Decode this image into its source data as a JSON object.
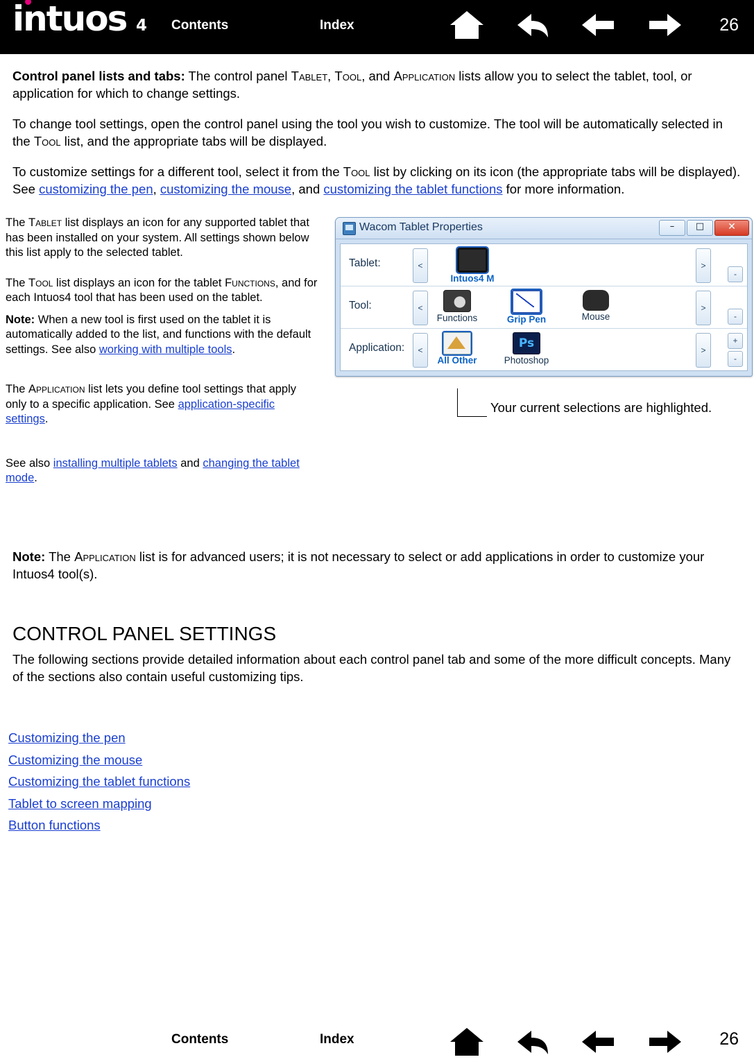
{
  "header": {
    "logo_text": "intuos",
    "logo_sub": "4",
    "contents_label": "Contents",
    "index_label": "Index",
    "page_number": "26",
    "icons": [
      "home-icon",
      "back-icon",
      "previous-page-icon",
      "next-page-icon"
    ]
  },
  "body": {
    "p1_bold": "Control panel lists and tabs:",
    "p1_a": " The control panel ",
    "p1_sc1": "Tablet",
    "p1_b": ", ",
    "p1_sc2": "Tool",
    "p1_c": ", and ",
    "p1_sc3": "Application",
    "p1_d": " lists allow you to select the tablet, tool, or application for which to change settings.",
    "p2_a": "To change tool settings, open the control panel using the tool you wish to customize.  The tool will be automatically selected in the ",
    "p2_sc": "Tool",
    "p2_b": " list, and the appropriate tabs will be displayed.",
    "p3_a": "To customize settings for a different tool, select it from the ",
    "p3_sc": "Tool",
    "p3_b": " list by clicking on its icon (the appropriate tabs will be displayed).  See ",
    "p3_link1": "customizing the pen",
    "p3_c": ", ",
    "p3_link2": "customizing the mouse",
    "p3_d": ", and ",
    "p3_link3": "customizing the tablet functions",
    "p3_e": " for more information."
  },
  "callouts": {
    "c1_a": "The ",
    "c1_sc": "Tablet",
    "c1_b": " list displays an icon for any supported tablet that has been installed on your system.  All settings shown below this list apply to the selected tablet.",
    "c2_a": "The ",
    "c2_sc1": "Tool",
    "c2_b": " list displays an icon for the tablet ",
    "c2_sc2": "Functions",
    "c2_c": ", and for each Intuos4 tool that has been used on the tablet.",
    "c3_bold": "Note:",
    "c3_a": " When a new tool is first used on the tablet it is automatically added to the list, and functions with the default settings.  See also ",
    "c3_link": "working with multiple tools",
    "c3_b": ".",
    "c4_a": "The ",
    "c4_sc": "Application",
    "c4_b": " list lets you define tool settings that apply only to a specific application.  See ",
    "c4_link": "application-specific settings",
    "c4_c": ".",
    "c5_a": "See also ",
    "c5_link1": "installing multiple tablets",
    "c5_b": " and ",
    "c5_link2": "changing the tablet mode",
    "c5_c": "."
  },
  "screenshot": {
    "window_title": "Wacom Tablet Properties",
    "window_icon": "tablet-properties-icon",
    "minimize_label": "–",
    "maximize_label": "□",
    "close_label": "✕",
    "rows": [
      {
        "label": "Tablet:",
        "left_arrow": "<",
        "right_arrow": ">",
        "stepper": [
          "-"
        ],
        "items": [
          {
            "caption": "Intuos4 M",
            "selected": true,
            "icon": "tablet-icon"
          }
        ]
      },
      {
        "label": "Tool:",
        "left_arrow": "<",
        "right_arrow": ">",
        "stepper": [
          "-"
        ],
        "items": [
          {
            "caption": "Functions",
            "selected": false,
            "icon": "functions-icon"
          },
          {
            "caption": "Grip Pen",
            "selected": true,
            "icon": "grip-pen-icon"
          },
          {
            "caption": "Mouse",
            "selected": false,
            "icon": "mouse-icon"
          }
        ]
      },
      {
        "label": "Application:",
        "left_arrow": "<",
        "right_arrow": ">",
        "stepper": [
          "+",
          "-"
        ],
        "items": [
          {
            "caption": "All Other",
            "selected": true,
            "icon": "all-other-icon"
          },
          {
            "caption": "Photoshop",
            "selected": false,
            "icon": "photoshop-icon"
          }
        ]
      }
    ]
  },
  "caption": "Your current selections are highlighted.",
  "note": {
    "bold": "Note:",
    "a": " The ",
    "sc": "Application",
    "b": " list is for advanced users; it is not necessary to select or add applications in order to customize your Intuos4 tool(s)."
  },
  "section": {
    "title": "CONTROL PANEL SETTINGS",
    "body": "The following sections provide detailed information about each control panel tab and some of the more difficult concepts.  Many of the sections also contain useful customizing tips."
  },
  "links": [
    "Customizing the pen",
    "Customizing the mouse",
    "Customizing the tablet functions",
    "Tablet to screen mapping",
    "Button functions"
  ],
  "footer": {
    "contents_label": "Contents",
    "index_label": "Index",
    "page_number": "26",
    "icons": [
      "home-icon",
      "back-icon",
      "previous-page-icon",
      "next-page-icon"
    ]
  }
}
